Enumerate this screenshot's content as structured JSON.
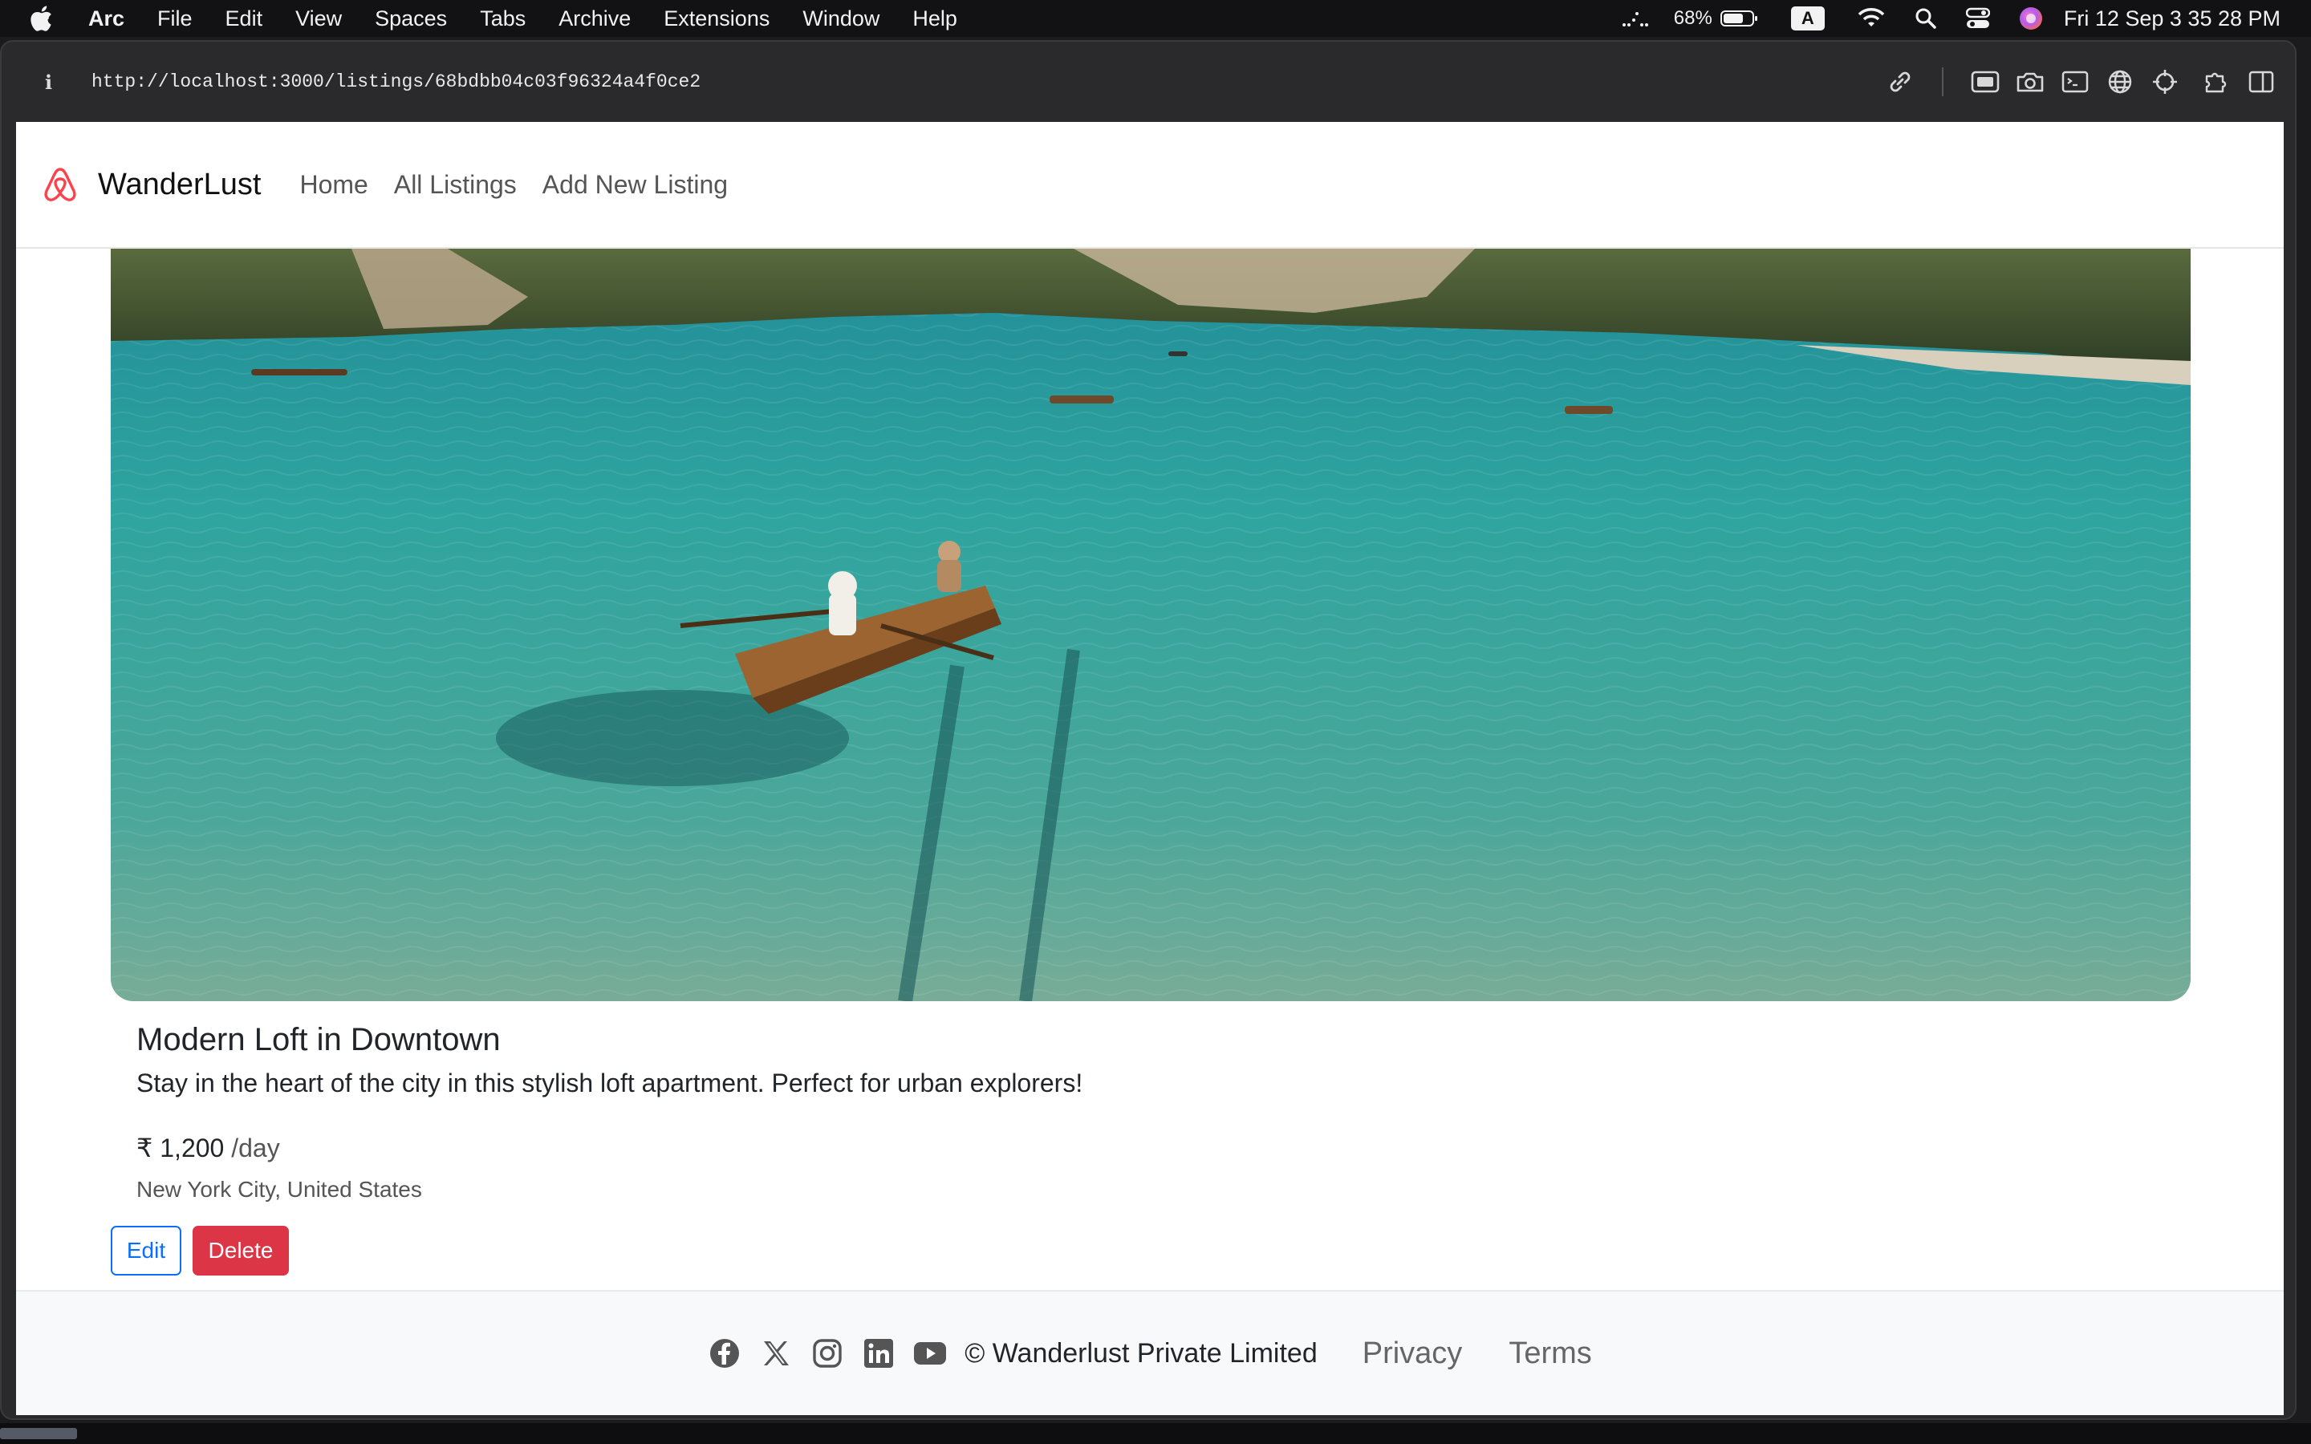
{
  "menubar": {
    "app": "Arc",
    "items": [
      "File",
      "Edit",
      "View",
      "Spaces",
      "Tabs",
      "Archive",
      "Extensions",
      "Window",
      "Help"
    ],
    "battery": "68%",
    "input_source": "A",
    "datetime": "Fri 12 Sep  3 35 28 PM"
  },
  "browser": {
    "url": "http://localhost:3000/listings/68bdbb04c03f96324a4f0ce2"
  },
  "navbar": {
    "brand": "WanderLust",
    "links": [
      "Home",
      "All Listings",
      "Add New Listing"
    ]
  },
  "listing": {
    "title": "Modern Loft in Downtown",
    "description": "Stay in the heart of the city in this stylish loft apartment. Perfect for urban explorers!",
    "price": "₹ 1,200",
    "per": "/day",
    "location": "New York City, United States",
    "edit_label": "Edit",
    "delete_label": "Delete"
  },
  "footer": {
    "copyright": "© Wanderlust Private Limited",
    "privacy": "Privacy",
    "terms": "Terms",
    "social_icons": [
      "facebook-icon",
      "x-icon",
      "instagram-icon",
      "linkedin-icon",
      "youtube-icon"
    ]
  },
  "colors": {
    "brand": "#fe424d",
    "primary": "#0d6efd",
    "danger": "#dc3545",
    "footer_bg": "#f8f9fa"
  }
}
